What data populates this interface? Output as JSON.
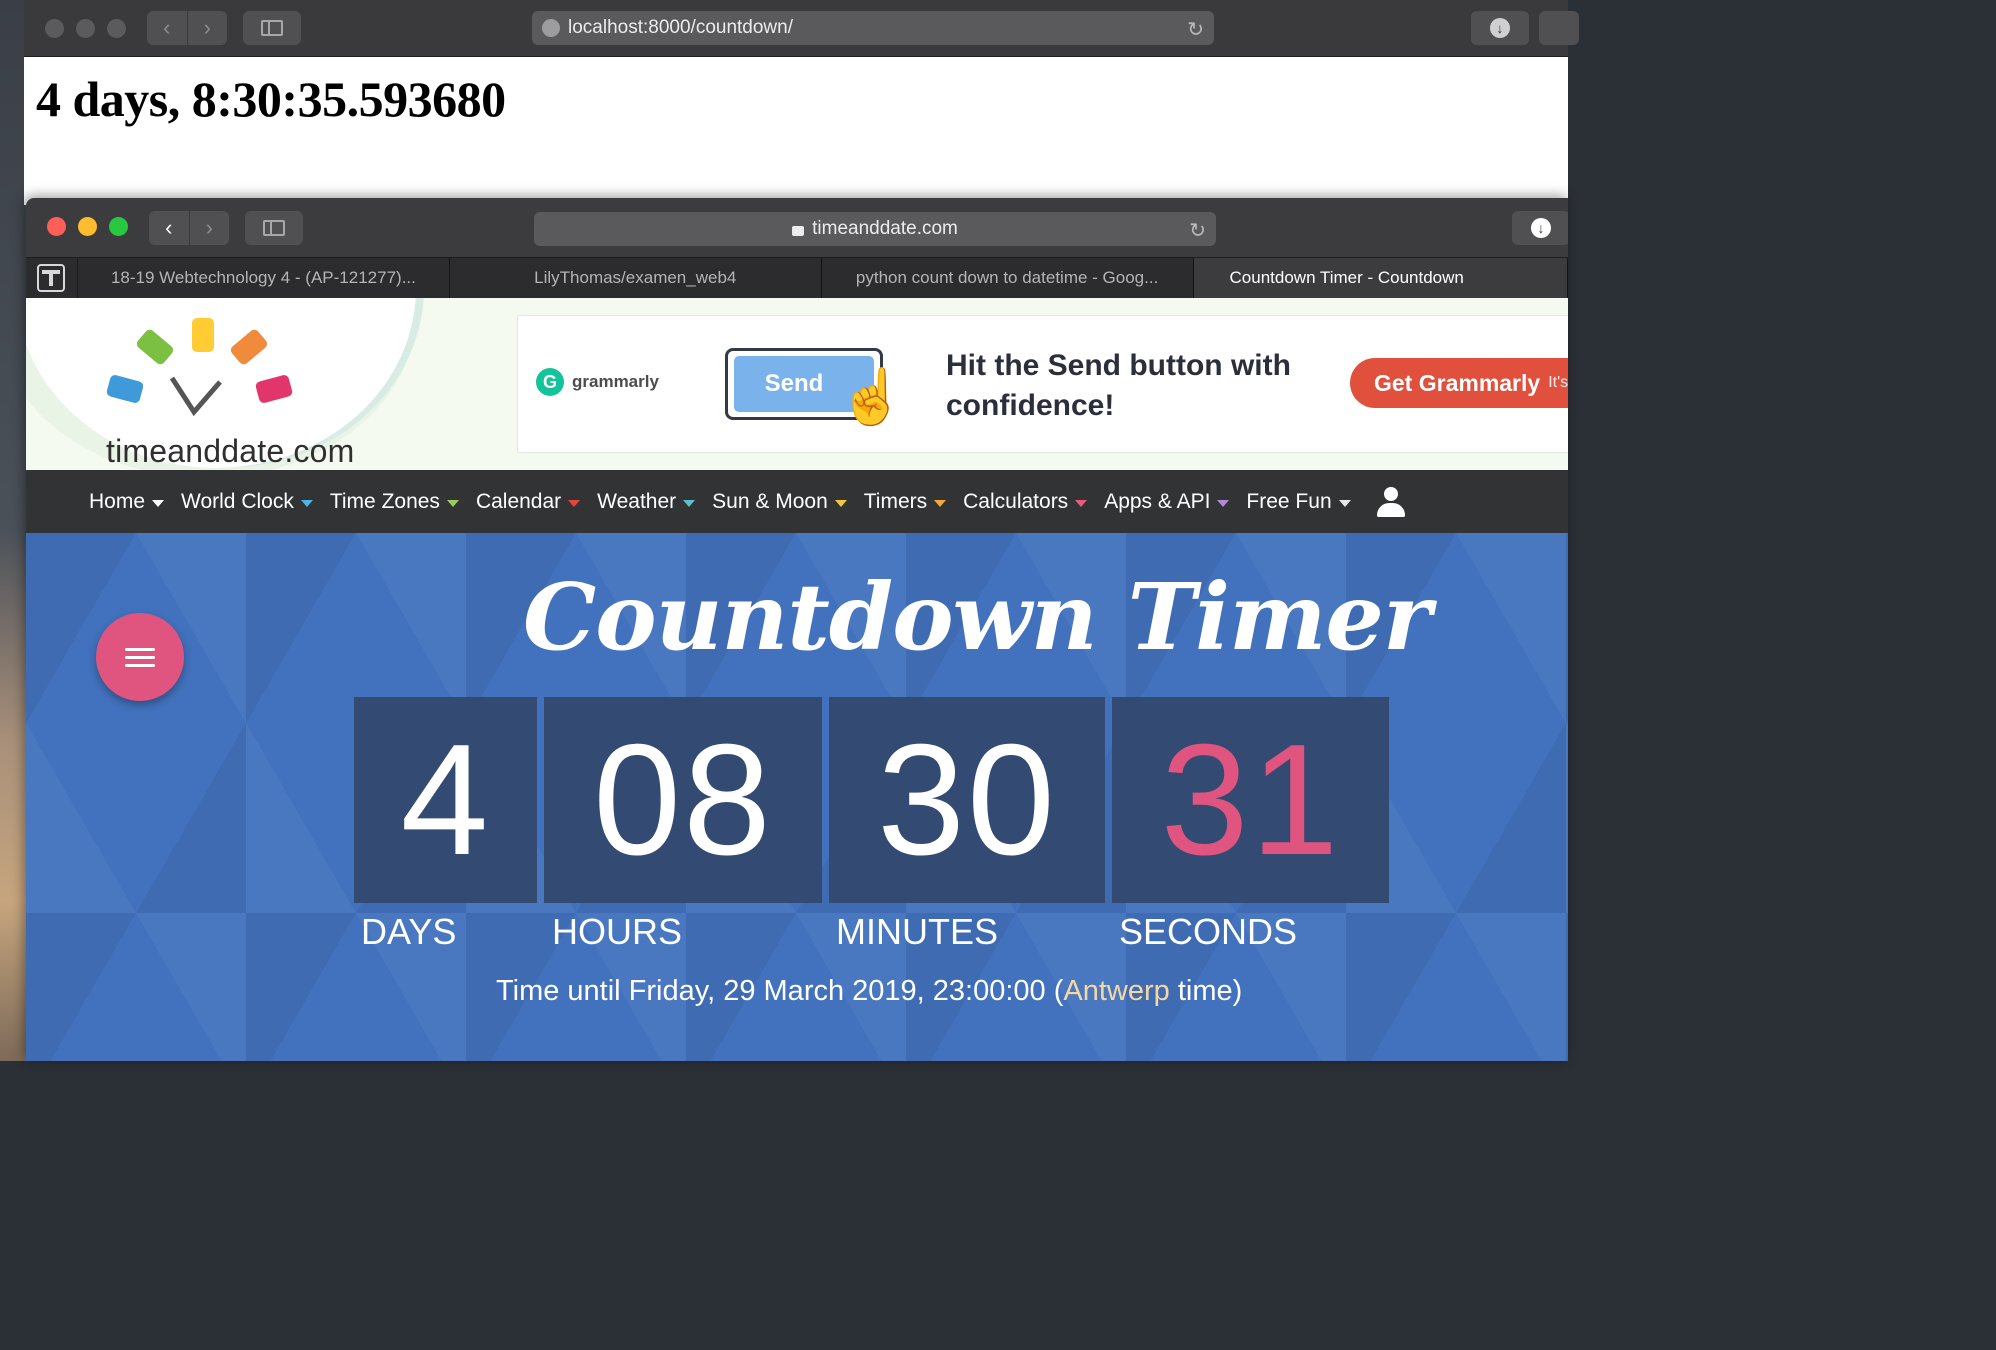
{
  "back_window": {
    "url": "localhost:8000/countdown/",
    "countdown_text": "4 days, 8:30:35.593680"
  },
  "front_window": {
    "url": "timeanddate.com",
    "tabs": [
      {
        "label": "18-19 Webtechnology 4 - (AP-121277)..."
      },
      {
        "label": "LilyThomas/examen_web4"
      },
      {
        "label": "python count down to datetime - Goog..."
      },
      {
        "label": "Countdown Timer - Countdown"
      }
    ]
  },
  "site": {
    "logo_text": "timeanddate.com",
    "logo_colors": [
      "#ffcc33",
      "#f08a3c",
      "#e2356c",
      "#3e9ad8",
      "#7cc043"
    ],
    "ad": {
      "brand": "grammarly",
      "button_label": "Send",
      "headline": "Hit the Send button with confidence!",
      "cta": "Get Grammarly",
      "cta_suffix": "It's"
    },
    "nav": [
      {
        "label": "Home",
        "caret_color": "#ffffff"
      },
      {
        "label": "World Clock",
        "caret_color": "#4fb3e3"
      },
      {
        "label": "Time Zones",
        "caret_color": "#9acd5f"
      },
      {
        "label": "Calendar",
        "caret_color": "#e7453d"
      },
      {
        "label": "Weather",
        "caret_color": "#5cc0c7"
      },
      {
        "label": "Sun & Moon",
        "caret_color": "#f2c744"
      },
      {
        "label": "Timers",
        "caret_color": "#f2a540"
      },
      {
        "label": "Calculators",
        "caret_color": "#e85b7f"
      },
      {
        "label": "Apps & API",
        "caret_color": "#b38ad9"
      },
      {
        "label": "Free Fun",
        "caret_color": "#e8e8e8"
      }
    ],
    "hero": {
      "title": "Countdown Timer",
      "counters": [
        {
          "value": "4",
          "unit": "DAYS"
        },
        {
          "value": "08",
          "unit": "HOURS"
        },
        {
          "value": "30",
          "unit": "MINUTES"
        },
        {
          "value": "31",
          "unit": "SECONDS"
        }
      ],
      "until_prefix": "Time until Friday, 29 March 2019, 23:00:00 (",
      "until_location": "Antwerp",
      "until_suffix": " time)"
    }
  }
}
